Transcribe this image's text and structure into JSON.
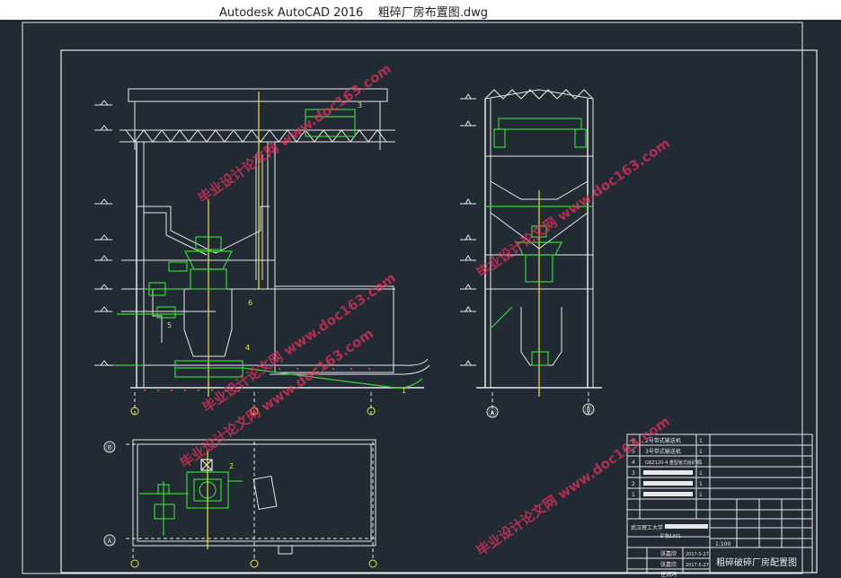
{
  "window": {
    "app_title": "Autodesk AutoCAD 2016",
    "file_name": "粗碎厂房布置图.dwg"
  },
  "drawing": {
    "views": {
      "section_a_grid": [
        "Ⓐ",
        "Ⓑ"
      ],
      "plan_grid": [
        "Ⓑ",
        "Ⓐ"
      ]
    },
    "callouts": [
      "1",
      "2",
      "3",
      "4",
      "5",
      "6"
    ],
    "watermark": "毕业设计论文网 www.doc163.com",
    "title_block": {
      "parts": [
        {
          "no": "6",
          "name": "2号带式输送机",
          "qty": "1"
        },
        {
          "no": "5",
          "name": "3号带式输送机",
          "qty": "1"
        },
        {
          "no": "4",
          "name": "GBZ120-4 重型板式给矿机",
          "qty": "1"
        },
        {
          "no": "3",
          "name": "",
          "qty": "1"
        },
        {
          "no": "2",
          "name": "",
          "qty": "1"
        },
        {
          "no": "1",
          "name": "",
          "qty": "1"
        }
      ],
      "school": "武汉理工大学",
      "dept": "矿物1301",
      "drawn_by": "张嘉欣",
      "checked_by": "张嘉欣",
      "approved_by": "任润玛",
      "date1": "2017-5-27",
      "date2": "2017-5-27",
      "scale": "1:100",
      "drawing_title": "粗碎破碎厂房配置图"
    }
  }
}
